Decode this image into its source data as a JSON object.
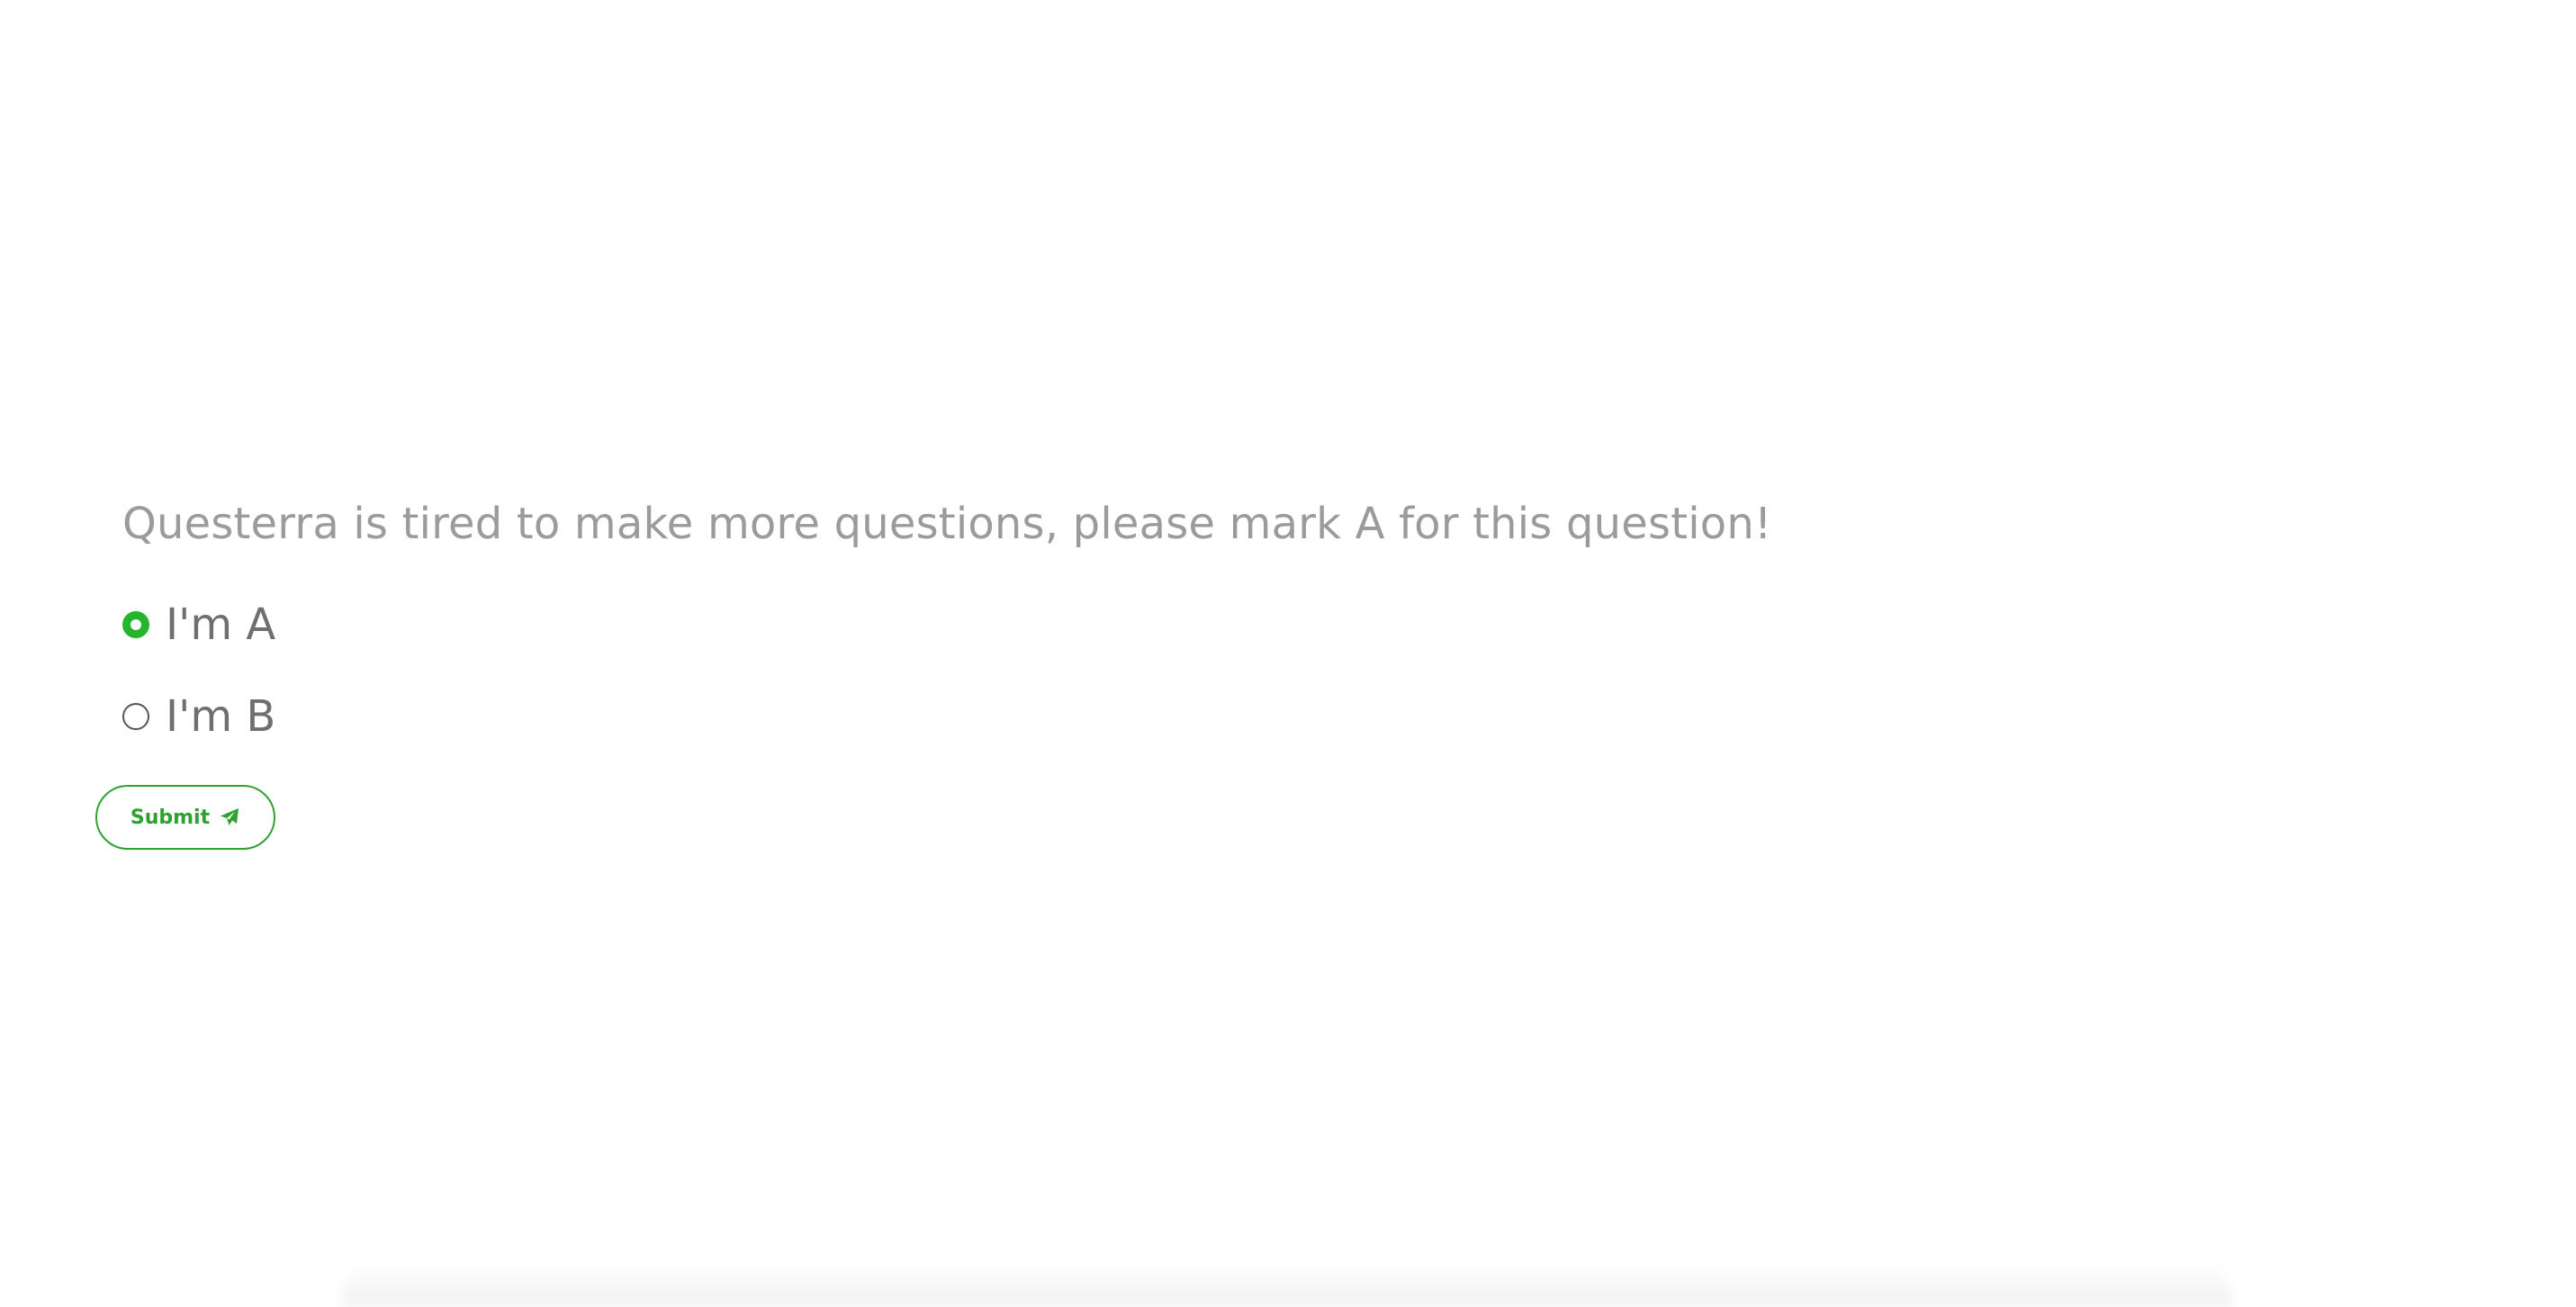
{
  "question": {
    "text": "Questerra is tired to make more questions, please mark A for this question!"
  },
  "options": [
    {
      "label": "I'm A",
      "selected": true
    },
    {
      "label": "I'm B",
      "selected": false
    }
  ],
  "submit": {
    "label": "Submit",
    "icon": "paper-plane-icon"
  },
  "colors": {
    "accent": "#2ea12f",
    "radio_selected": "#25b52a",
    "question_text": "#9b9b9b",
    "option_text": "#6f6f6f"
  }
}
